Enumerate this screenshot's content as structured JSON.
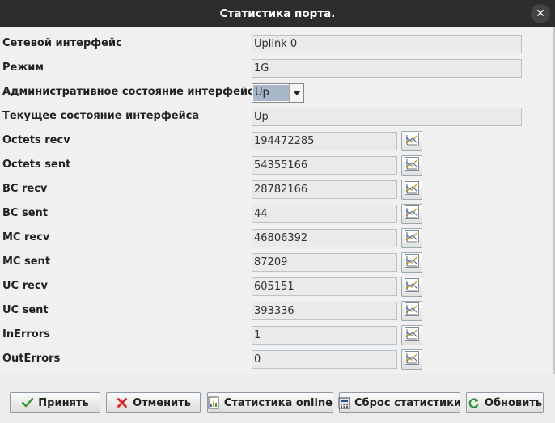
{
  "window": {
    "title": "Статистика порта."
  },
  "fields": [
    {
      "label": "Сетевой интерфейс",
      "value": "Uplink 0"
    },
    {
      "label": "Режим",
      "value": "1G"
    },
    {
      "label": "Административное состояние интерфейса",
      "value": "Up"
    },
    {
      "label": "Текущее состояние интерфейса",
      "value": "Up"
    },
    {
      "label": "Octets recv",
      "value": "194472285"
    },
    {
      "label": "Octets sent",
      "value": "54355166"
    },
    {
      "label": "BC recv",
      "value": "28782166"
    },
    {
      "label": "BC sent",
      "value": "44"
    },
    {
      "label": "MC recv",
      "value": "46806392"
    },
    {
      "label": "MC sent",
      "value": "87209"
    },
    {
      "label": "UC recv",
      "value": "605151"
    },
    {
      "label": "UC sent",
      "value": "393336"
    },
    {
      "label": "InErrors",
      "value": "1"
    },
    {
      "label": "OutErrors",
      "value": "0"
    }
  ],
  "buttons": {
    "accept": "Принять",
    "cancel": "Отменить",
    "online_stats": "Статистика online",
    "reset_stats": "Сброс статистики",
    "refresh": "Обновить"
  },
  "icons": {
    "close": "close-icon",
    "graph": "chart-icon",
    "accept": "checkmark-icon",
    "cancel": "cross-icon",
    "online_stats": "document-chart-icon",
    "reset_stats": "calculator-icon",
    "refresh": "refresh-icon"
  }
}
